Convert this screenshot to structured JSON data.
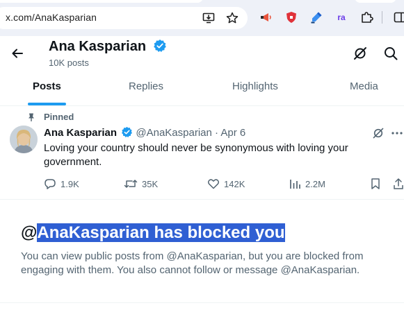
{
  "browser": {
    "url": "x.com/AnaKasparian",
    "extension_icons": [
      "megaphone-icon",
      "shield-icon",
      "highlighter-icon",
      "ra-icon",
      "puzzle-icon"
    ],
    "ra_label": "ra"
  },
  "profile": {
    "name": "Ana Kasparian",
    "post_count": "10K posts"
  },
  "tabs": [
    {
      "label": "Posts",
      "active": true
    },
    {
      "label": "Replies",
      "active": false
    },
    {
      "label": "Highlights",
      "active": false
    },
    {
      "label": "Media",
      "active": false
    }
  ],
  "post": {
    "pinned_label": "Pinned",
    "author_name": "Ana Kasparian",
    "author_handle": "@AnaKasparian",
    "separator": "·",
    "date": "Apr 6",
    "text": "Loving your country should never be synonymous with loving your government.",
    "replies": "1.9K",
    "reposts": "35K",
    "likes": "142K",
    "views": "2.2M"
  },
  "blocked": {
    "prefix": "@",
    "highlighted": "AnaKasparian has blocked you",
    "description": "You can view public posts from @AnaKasparian, but you are blocked from engaging with them. You also cannot follow or message @AnaKasparian."
  },
  "colors": {
    "accent": "#1d9bf0",
    "text_primary": "#0f1419",
    "text_secondary": "#536471",
    "selection": "#2f5fd3"
  }
}
